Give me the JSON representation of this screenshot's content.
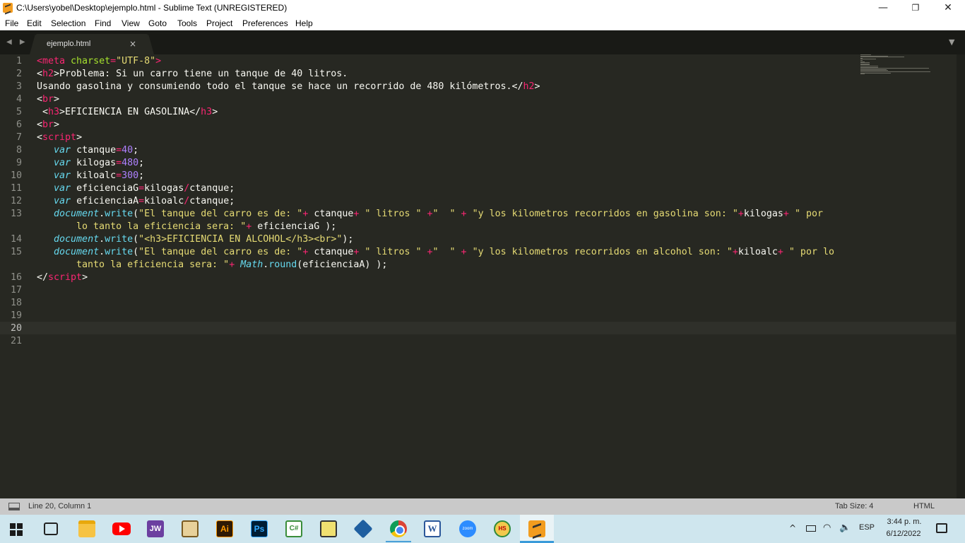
{
  "window": {
    "title": "C:\\Users\\yobel\\Desktop\\ejemplo.html - Sublime Text (UNREGISTERED)",
    "minimize": "—",
    "maximize": "❐",
    "close": "✕"
  },
  "menu": [
    "File",
    "Edit",
    "Selection",
    "Find",
    "View",
    "Goto",
    "Tools",
    "Project",
    "Preferences",
    "Help"
  ],
  "tabs": {
    "nav": "◀ ▶",
    "active": "ejemplo.html",
    "close": "×",
    "dropdown": "▼"
  },
  "editor": {
    "line_numbers": [
      "1",
      "2",
      "3",
      "4",
      "5",
      "6",
      "7",
      "8",
      "9",
      "10",
      "11",
      "12",
      "13",
      "",
      "14",
      "15",
      "",
      "16",
      "17",
      "18",
      "19",
      "20",
      "21"
    ],
    "current_line": "20",
    "lines": [
      [
        [
          "t",
          "<meta "
        ],
        [
          "a",
          "charset"
        ],
        [
          "t",
          "="
        ],
        [
          "s",
          "\"UTF-8\""
        ],
        [
          "t",
          ">"
        ]
      ],
      [
        [
          "w",
          "<"
        ],
        [
          "t",
          "h2"
        ],
        [
          "w",
          ">Problema: Si un carro tiene un tanque de 40 litros."
        ]
      ],
      [
        [
          "w",
          "Usando gasolina y consumiendo todo el tanque se hace un recorrido de 480 kilómetros.</"
        ],
        [
          "t",
          "h2"
        ],
        [
          "w",
          ">"
        ]
      ],
      [
        [
          "w",
          "<"
        ],
        [
          "t",
          "br"
        ],
        [
          "w",
          ">"
        ]
      ],
      [
        [
          "w",
          " <"
        ],
        [
          "t",
          "h3"
        ],
        [
          "w",
          ">EFICIENCIA EN GASOLINA</"
        ],
        [
          "t",
          "h3"
        ],
        [
          "w",
          ">"
        ]
      ],
      [
        [
          "w",
          "<"
        ],
        [
          "t",
          "br"
        ],
        [
          "w",
          ">"
        ]
      ],
      [
        [
          "w",
          "<"
        ],
        [
          "t",
          "script"
        ],
        [
          "w",
          ">"
        ]
      ],
      [
        [
          "w",
          "   "
        ],
        [
          "k",
          "var"
        ],
        [
          "w",
          " ctanque"
        ],
        [
          "t",
          "="
        ],
        [
          "n",
          "40"
        ],
        [
          "w",
          ";"
        ]
      ],
      [
        [
          "w",
          "   "
        ],
        [
          "k",
          "var"
        ],
        [
          "w",
          " kilogas"
        ],
        [
          "t",
          "="
        ],
        [
          "n",
          "480"
        ],
        [
          "w",
          ";"
        ]
      ],
      [
        [
          "w",
          "   "
        ],
        [
          "k",
          "var"
        ],
        [
          "w",
          " kiloalc"
        ],
        [
          "t",
          "="
        ],
        [
          "n",
          "300"
        ],
        [
          "w",
          ";"
        ]
      ],
      [
        [
          "w",
          "   "
        ],
        [
          "k",
          "var"
        ],
        [
          "w",
          " eficienciaG"
        ],
        [
          "t",
          "="
        ],
        [
          "w",
          "kilogas"
        ],
        [
          "t",
          "/"
        ],
        [
          "w",
          "ctanque;"
        ]
      ],
      [
        [
          "w",
          "   "
        ],
        [
          "k",
          "var"
        ],
        [
          "w",
          " eficienciaA"
        ],
        [
          "t",
          "="
        ],
        [
          "w",
          "kiloalc"
        ],
        [
          "t",
          "/"
        ],
        [
          "w",
          "ctanque;"
        ]
      ],
      [
        [
          "w",
          "   "
        ],
        [
          "k",
          "document"
        ],
        [
          "w",
          "."
        ],
        [
          "f",
          "write"
        ],
        [
          "w",
          "("
        ],
        [
          "s",
          "\"El tanque del carro es de: \""
        ],
        [
          "t",
          "+"
        ],
        [
          "w",
          " ctanque"
        ],
        [
          "t",
          "+"
        ],
        [
          "w",
          " "
        ],
        [
          "s",
          "\" litros \""
        ],
        [
          "w",
          " "
        ],
        [
          "t",
          "+"
        ],
        [
          "s",
          "\"  \""
        ],
        [
          "w",
          " "
        ],
        [
          "t",
          "+"
        ],
        [
          "w",
          " "
        ],
        [
          "s",
          "\"y los kilometros recorridos en gasolina son: \""
        ],
        [
          "t",
          "+"
        ],
        [
          "w",
          "kilogas"
        ],
        [
          "t",
          "+"
        ],
        [
          "w",
          " "
        ],
        [
          "s",
          "\" por"
        ]
      ],
      [
        [
          "s",
          "       lo tanto la eficiencia sera: \""
        ],
        [
          "t",
          "+"
        ],
        [
          "w",
          " eficienciaG );"
        ]
      ],
      [
        [
          "w",
          "   "
        ],
        [
          "k",
          "document"
        ],
        [
          "w",
          "."
        ],
        [
          "f",
          "write"
        ],
        [
          "w",
          "("
        ],
        [
          "s",
          "\"<h3>EFICIENCIA EN ALCOHOL</h3><br>\""
        ],
        [
          "w",
          ");"
        ]
      ],
      [
        [
          "w",
          "   "
        ],
        [
          "k",
          "document"
        ],
        [
          "w",
          "."
        ],
        [
          "f",
          "write"
        ],
        [
          "w",
          "("
        ],
        [
          "s",
          "\"El tanque del carro es de: \""
        ],
        [
          "t",
          "+"
        ],
        [
          "w",
          " ctanque"
        ],
        [
          "t",
          "+"
        ],
        [
          "w",
          " "
        ],
        [
          "s",
          "\" litros \""
        ],
        [
          "w",
          " "
        ],
        [
          "t",
          "+"
        ],
        [
          "s",
          "\"  \""
        ],
        [
          "w",
          " "
        ],
        [
          "t",
          "+"
        ],
        [
          "w",
          " "
        ],
        [
          "s",
          "\"y los kilometros recorridos en alcohol son: \""
        ],
        [
          "t",
          "+"
        ],
        [
          "w",
          "kiloalc"
        ],
        [
          "t",
          "+"
        ],
        [
          "w",
          " "
        ],
        [
          "s",
          "\" por lo"
        ]
      ],
      [
        [
          "s",
          "       tanto la eficiencia sera: \""
        ],
        [
          "t",
          "+"
        ],
        [
          "w",
          " "
        ],
        [
          "k",
          "Math"
        ],
        [
          "w",
          "."
        ],
        [
          "f",
          "round"
        ],
        [
          "w",
          "(eficienciaA) );"
        ]
      ],
      [
        [
          "w",
          "</"
        ],
        [
          "t",
          "script"
        ],
        [
          "w",
          ">"
        ]
      ],
      [],
      [],
      [],
      [],
      []
    ]
  },
  "statusbar": {
    "position": "Line 20, Column 1",
    "tab_size": "Tab Size: 4",
    "syntax": "HTML"
  },
  "taskbar": {
    "icons": [
      "windows-start-icon",
      "task-view-icon",
      "file-explorer-icon",
      "youtube-icon",
      "jw-icon",
      "folder-icon",
      "illustrator-icon",
      "photoshop-icon",
      "csharp-icon",
      "tool-icon",
      "virtualbox-icon",
      "chrome-icon",
      "word-icon",
      "zoom-icon",
      "hs-icon",
      "sublime-text-icon"
    ],
    "jw_label": "JW",
    "ai_label": "Ai",
    "ps_label": "Ps",
    "cs_label": "C#",
    "word_label": "W",
    "zoom_label": "zoom",
    "hs_label": "HS",
    "tray_chevron": "^",
    "wifi": "◠",
    "volume": "🔈",
    "language": "ESP",
    "time": "3:44 p. m.",
    "date": "6/12/2022"
  },
  "colors": {
    "editor_bg": "#272822",
    "tag": "#f92672",
    "attribute": "#a6e22e",
    "string": "#e6db74",
    "number": "#ae81ff",
    "keyword": "#66d9ef",
    "text": "#f8f8f2"
  }
}
